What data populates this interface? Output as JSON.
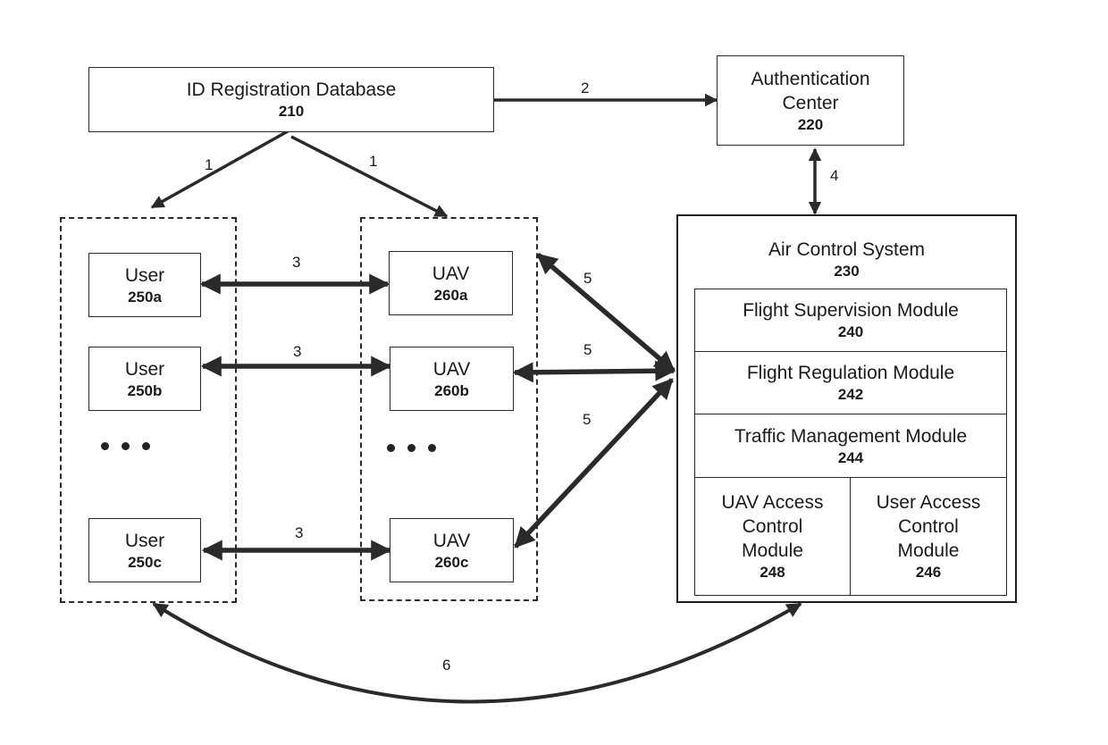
{
  "diagram": {
    "nodes": {
      "id_registration": {
        "name": "ID Registration Database",
        "ref": "210"
      },
      "authentication_center": {
        "name": "Authentication\nCenter",
        "line1": "Authentication",
        "line2": "Center",
        "ref": "220"
      },
      "air_control_system": {
        "name": "Air Control System",
        "ref": "230",
        "modules": [
          {
            "name": "Flight Supervision Module",
            "ref": "240"
          },
          {
            "name": "Flight Regulation Module",
            "ref": "242"
          },
          {
            "name": "Traffic Management Module",
            "ref": "244"
          },
          {
            "line1": "UAV Access",
            "line2": "Control",
            "line3": "Module",
            "ref": "248"
          },
          {
            "line1": "User Access",
            "line2": "Control",
            "line3": "Module",
            "ref": "246"
          }
        ]
      },
      "users": [
        {
          "name": "User",
          "ref": "250a"
        },
        {
          "name": "User",
          "ref": "250b"
        },
        {
          "name": "User",
          "ref": "250c"
        }
      ],
      "uavs": [
        {
          "name": "UAV",
          "ref": "260a"
        },
        {
          "name": "UAV",
          "ref": "260b"
        },
        {
          "name": "UAV",
          "ref": "260c"
        }
      ]
    },
    "edges": [
      {
        "id": "e1a",
        "label": "1",
        "from": "ID Registration Database",
        "to": "User group",
        "direction": "one-way"
      },
      {
        "id": "e1b",
        "label": "1",
        "from": "ID Registration Database",
        "to": "UAV group",
        "direction": "one-way"
      },
      {
        "id": "e2",
        "label": "2",
        "from": "ID Registration Database",
        "to": "Authentication Center",
        "direction": "one-way"
      },
      {
        "id": "e3a",
        "label": "3",
        "from": "User 250a",
        "to": "UAV 260a",
        "direction": "two-way"
      },
      {
        "id": "e3b",
        "label": "3",
        "from": "User 250b",
        "to": "UAV 260b",
        "direction": "two-way"
      },
      {
        "id": "e3c",
        "label": "3",
        "from": "User 250c",
        "to": "UAV 260c",
        "direction": "two-way"
      },
      {
        "id": "e4",
        "label": "4",
        "from": "Authentication Center",
        "to": "Air Control System",
        "direction": "two-way"
      },
      {
        "id": "e5a",
        "label": "5",
        "from": "UAV group",
        "to": "Air Control System",
        "direction": "two-way"
      },
      {
        "id": "e5b",
        "label": "5",
        "from": "UAV 260b",
        "to": "Air Control System",
        "direction": "two-way"
      },
      {
        "id": "e5c",
        "label": "5",
        "from": "UAV 260c",
        "to": "Air Control System",
        "direction": "two-way"
      },
      {
        "id": "e6",
        "label": "6",
        "from": "User group",
        "to": "Air Control System",
        "direction": "two-way"
      }
    ],
    "ellipsis": "•••"
  }
}
